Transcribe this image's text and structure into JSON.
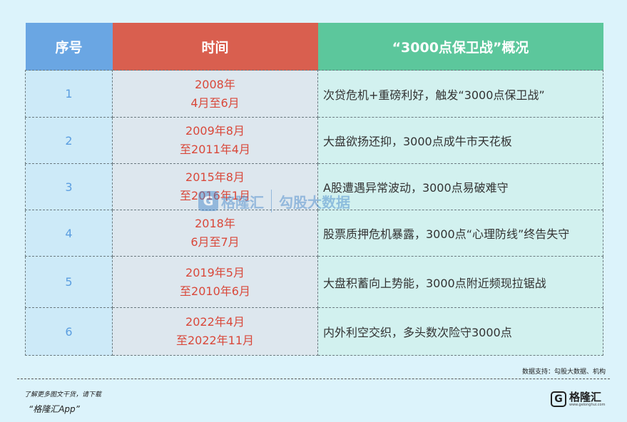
{
  "table": {
    "headers": [
      "序号",
      "时间",
      "“3000点保卫战”概况"
    ],
    "rows": [
      {
        "no": "1",
        "time1": "2008年",
        "time2": "4月至6月",
        "desc": "次贷危机+重磅利好，触发“3000点保卫战”"
      },
      {
        "no": "2",
        "time1": "2009年8月",
        "time2": "至2011年4月",
        "desc": "大盘欲扬还抑，3000点成牛市天花板"
      },
      {
        "no": "3",
        "time1": "2015年8月",
        "time2": "至2016年1月",
        "desc": "A股遭遇异常波动，3000点易破难守"
      },
      {
        "no": "4",
        "time1": "2018年",
        "time2": "6月至7月",
        "desc": "股票质押危机暴露，3000点“心理防线”终告失守"
      },
      {
        "no": "5",
        "time1": "2019年5月",
        "time2": "至2010年6月",
        "desc": "大盘积蓄向上势能，3000点附近频现拉锯战"
      },
      {
        "no": "6",
        "time1": "2022年4月",
        "time2": "至2022年11月",
        "desc": "内外利空交织，多头数次险守3000点"
      }
    ]
  },
  "watermark": {
    "name": "格隆汇",
    "name2": "勾股大数据"
  },
  "source": "数据支持：勾股大数据、机构",
  "footer": {
    "line1": "了解更多图文干货，请下载",
    "line2": "“格隆汇App”"
  },
  "brand": {
    "logo": "G",
    "name": "格隆汇",
    "url": "www.gelonghui.com"
  }
}
